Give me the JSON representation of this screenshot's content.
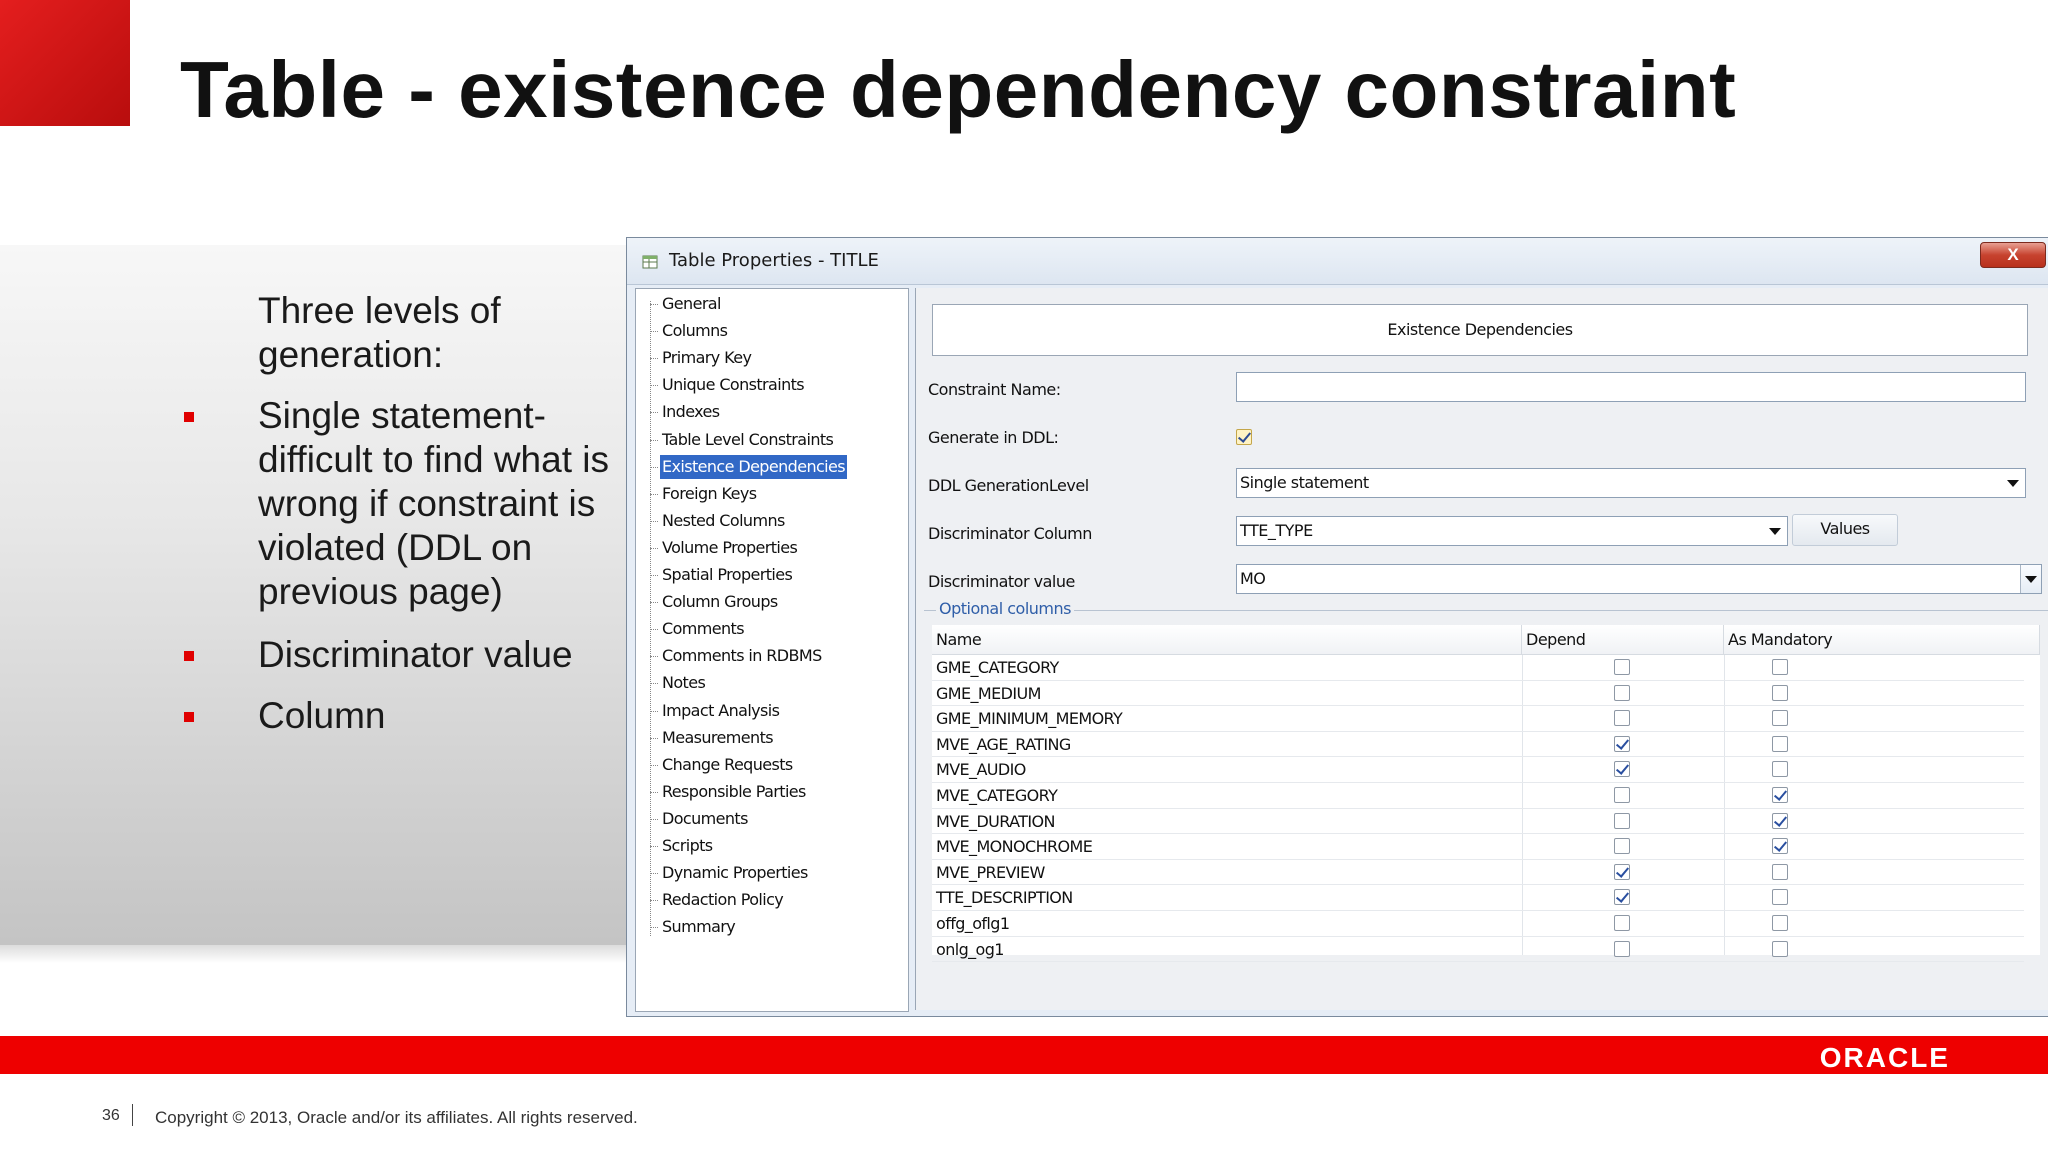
{
  "slide": {
    "title": "Table - existence dependency constraint",
    "intro": "Three levels of generation:",
    "bullets": [
      "Single statement- difficult to find what is wrong if constraint is violated (DDL on previous page)",
      "Discriminator value",
      "Column"
    ],
    "page_number": "36",
    "copyright": "Copyright © 2013, Oracle and/or its affiliates. All rights reserved.",
    "brand": "ORACLE",
    "colors": {
      "accent": "#ee0000"
    }
  },
  "dialog": {
    "title": "Table Properties - TITLE",
    "close_label": "X",
    "nav_items": [
      "General",
      "Columns",
      "Primary Key",
      "Unique Constraints",
      "Indexes",
      "Table Level Constraints",
      "Existence Dependencies",
      "Foreign Keys",
      "Nested Columns",
      "Volume Properties",
      "Spatial Properties",
      "Column Groups",
      "Comments",
      "Comments in RDBMS",
      "Notes",
      "Impact Analysis",
      "Measurements",
      "Change Requests",
      "Responsible Parties",
      "Documents",
      "Scripts",
      "Dynamic Properties",
      "Redaction Policy",
      "Summary"
    ],
    "selected_nav": "Existence Dependencies",
    "section_title": "Existence Dependencies",
    "form": {
      "constraint_name_label": "Constraint Name:",
      "constraint_name_value": "",
      "generate_ddl_label": "Generate in DDL:",
      "generate_ddl_checked": true,
      "ddl_level_label": "DDL GenerationLevel",
      "ddl_level_value": "Single statement",
      "discriminator_column_label": "Discriminator Column",
      "discriminator_column_value": "TTE_TYPE",
      "values_button": "Values",
      "discriminator_value_label": "Discriminator value",
      "discriminator_value_value": "MO"
    },
    "optional_columns": {
      "legend": "Optional columns",
      "headers": {
        "name": "Name",
        "depend": "Depend",
        "mandatory": "As Mandatory"
      },
      "rows": [
        {
          "name": "GME_CATEGORY",
          "depend": false,
          "mandatory": false
        },
        {
          "name": "GME_MEDIUM",
          "depend": false,
          "mandatory": false
        },
        {
          "name": "GME_MINIMUM_MEMORY",
          "depend": false,
          "mandatory": false
        },
        {
          "name": "MVE_AGE_RATING",
          "depend": true,
          "mandatory": false
        },
        {
          "name": "MVE_AUDIO",
          "depend": true,
          "mandatory": false
        },
        {
          "name": "MVE_CATEGORY",
          "depend": false,
          "mandatory": true
        },
        {
          "name": "MVE_DURATION",
          "depend": false,
          "mandatory": true
        },
        {
          "name": "MVE_MONOCHROME",
          "depend": false,
          "mandatory": true
        },
        {
          "name": "MVE_PREVIEW",
          "depend": true,
          "mandatory": false
        },
        {
          "name": "TTE_DESCRIPTION",
          "depend": true,
          "mandatory": false
        },
        {
          "name": "offg_oflg1",
          "depend": false,
          "mandatory": false
        },
        {
          "name": "onlg_og1",
          "depend": false,
          "mandatory": false
        }
      ]
    }
  }
}
